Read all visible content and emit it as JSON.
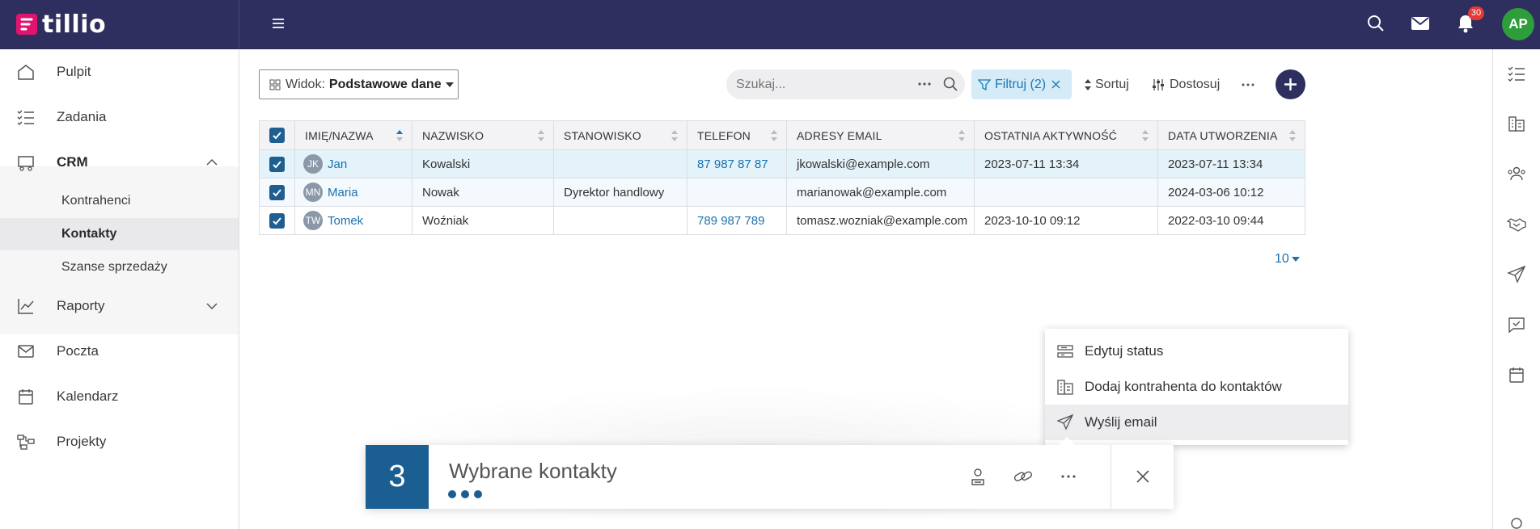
{
  "app": {
    "logo_text": "tillio"
  },
  "topbar": {
    "notifications_count": "30",
    "user_initials": "AP"
  },
  "sidebar": {
    "items": [
      {
        "label": "Pulpit",
        "icon": "home-icon"
      },
      {
        "label": "Zadania",
        "icon": "tasks-icon"
      },
      {
        "label": "CRM",
        "icon": "crm-icon"
      },
      {
        "label": "Raporty",
        "icon": "chart-icon"
      },
      {
        "label": "Poczta",
        "icon": "mail-icon"
      },
      {
        "label": "Kalendarz",
        "icon": "calendar-icon"
      },
      {
        "label": "Projekty",
        "icon": "projects-icon"
      }
    ],
    "crm_sub": [
      {
        "label": "Kontrahenci"
      },
      {
        "label": "Kontakty"
      },
      {
        "label": "Szanse sprzedaży"
      }
    ]
  },
  "toolbar": {
    "view_prefix": "Widok:",
    "view_value": "Podstawowe dane",
    "search_placeholder": "Szukaj...",
    "filter_label": "Filtruj (2)",
    "sort_label": "Sortuj",
    "customize_label": "Dostosuj"
  },
  "table": {
    "headers": [
      "IMIĘ/NAZWA",
      "NAZWISKO",
      "STANOWISKO",
      "TELEFON",
      "ADRESY EMAIL",
      "OSTATNIA AKTYWNOŚĆ",
      "DATA UTWORZENIA"
    ],
    "rows": [
      {
        "initials": "JK",
        "name": "Jan",
        "surname": "Kowalski",
        "position": "",
        "phone": "87 987 87 87",
        "email": "jkowalski@example.com",
        "last_activity": "2023-07-11 13:34",
        "created": "2023-07-11 13:34"
      },
      {
        "initials": "MN",
        "name": "Maria",
        "surname": "Nowak",
        "position": "Dyrektor handlowy",
        "phone": "",
        "email": "marianowak@example.com",
        "last_activity": "",
        "created": "2024-03-06 10:12"
      },
      {
        "initials": "TW",
        "name": "Tomek",
        "surname": "Woźniak",
        "position": "",
        "phone": "789 987 789",
        "email": "tomasz.wozniak@example.com",
        "last_activity": "2023-10-10 09:12",
        "created": "2022-03-10 09:44"
      }
    ]
  },
  "pager": {
    "page_size": "10"
  },
  "context_menu": {
    "items": [
      {
        "label": "Edytuj status",
        "icon": "status-icon"
      },
      {
        "label": "Dodaj kontrahenta do kontaktów",
        "icon": "building-icon"
      },
      {
        "label": "Wyślij email",
        "icon": "send-icon"
      }
    ]
  },
  "selection_bar": {
    "count": "3",
    "title": "Wybrane kontakty"
  },
  "colors": {
    "topbar": "#2e2f5e",
    "accent": "#1b5e92",
    "link": "#1a72b0",
    "brand": "#e2136e",
    "avatar": "#2e9e3a"
  }
}
